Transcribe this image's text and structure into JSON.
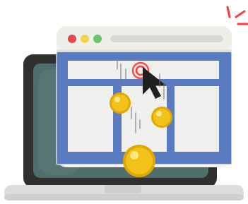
{
  "illustration": {
    "subject": "laptop-browser-click-coins",
    "colors": {
      "laptop_body": "#2f2f2f",
      "laptop_screen": "#4f6d6b",
      "laptop_base": "#dcdcdc",
      "browser_frame": "#f2f2ee",
      "browser_content_bg": "#5b7bc1",
      "panel": "#efefed",
      "dot_red": "#e24b4b",
      "dot_yellow": "#f2d34b",
      "dot_green": "#69c46a",
      "coin": "#f2c21b",
      "coin_rim": "#e0a800",
      "cursor": "#1f1f1f",
      "click_ring": "#ff3b3b",
      "spark": "#ff3b3b"
    },
    "icons": {
      "cursor": "cursor-arrow-icon",
      "click": "click-ripple-icon",
      "coin": "gold-coin-icon",
      "spark": "spark-lines-icon"
    }
  }
}
